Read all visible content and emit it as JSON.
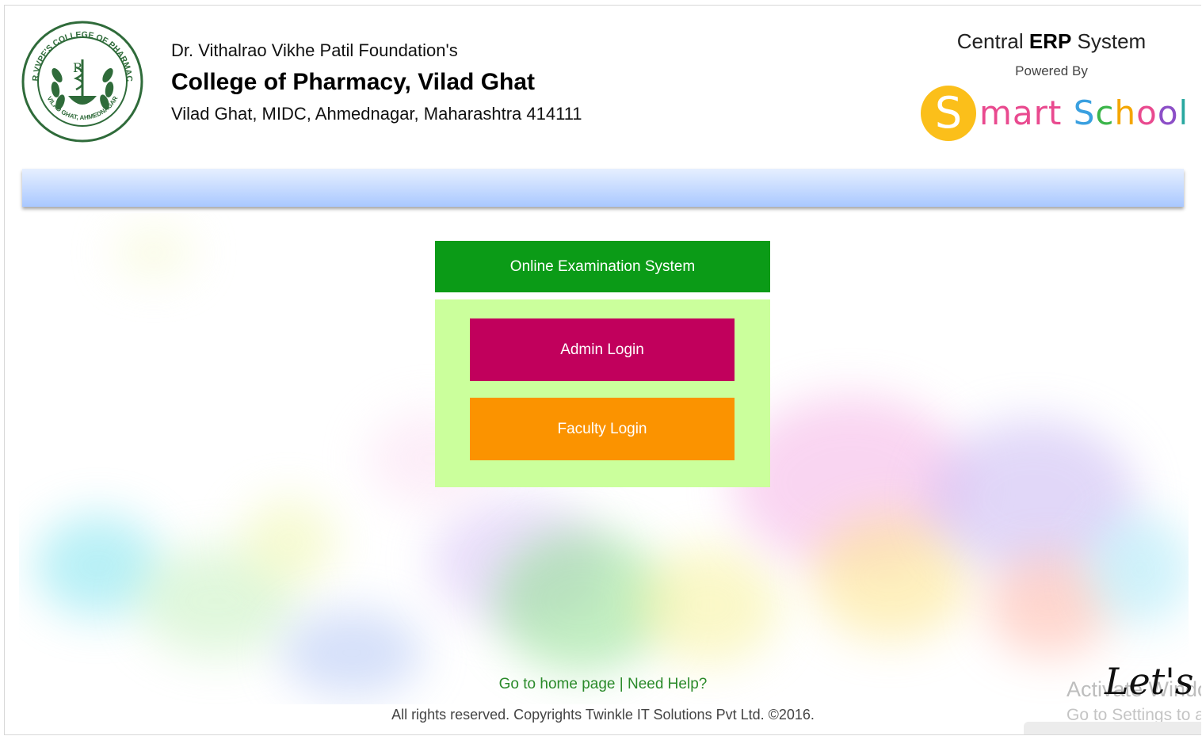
{
  "header": {
    "foundation": "Dr. Vithalrao Vikhe Patil Foundation's",
    "college_name": "College of Pharmacy, Vilad Ghat",
    "address": "Vilad Ghat, MIDC, Ahmednagar, Maharashtra 414111",
    "logo_text": "DR.VVPF'S COLLEGE OF PHARMACY",
    "logo_text_bottom": "VILAD GHAT, AHMEDNAGAR"
  },
  "erp": {
    "title_prefix": "Central ",
    "title_bold": "ERP",
    "title_suffix": " System",
    "powered_by": "Powered By",
    "brand_s": "S",
    "brand_mart": "mart",
    "brand_school": "School"
  },
  "panel": {
    "title": "Online Examination System",
    "admin_login": "Admin Login",
    "faculty_login": "Faculty Login"
  },
  "footer": {
    "home_link": "Go to home page",
    "separator": "|",
    "help_link": "Need Help?",
    "copyright": "All rights reserved. Copyrights Twinkle IT Solutions Pvt Ltd. ©2016."
  },
  "overlay": {
    "activate_title": "Activate Windows",
    "activate_sub": "Go to Settings to activate Windows.",
    "chat_widget": "Let's"
  },
  "colors": {
    "exam_header": "#0b9b17",
    "login_panel": "#cbff9c",
    "admin_button": "#c1005c",
    "faculty_button": "#fb9300",
    "navbar_top": "#e6efff",
    "navbar_bottom": "#a9c8ff",
    "footer_link": "#2a8a2a",
    "smart_s_circle": "#fbbf1a"
  }
}
